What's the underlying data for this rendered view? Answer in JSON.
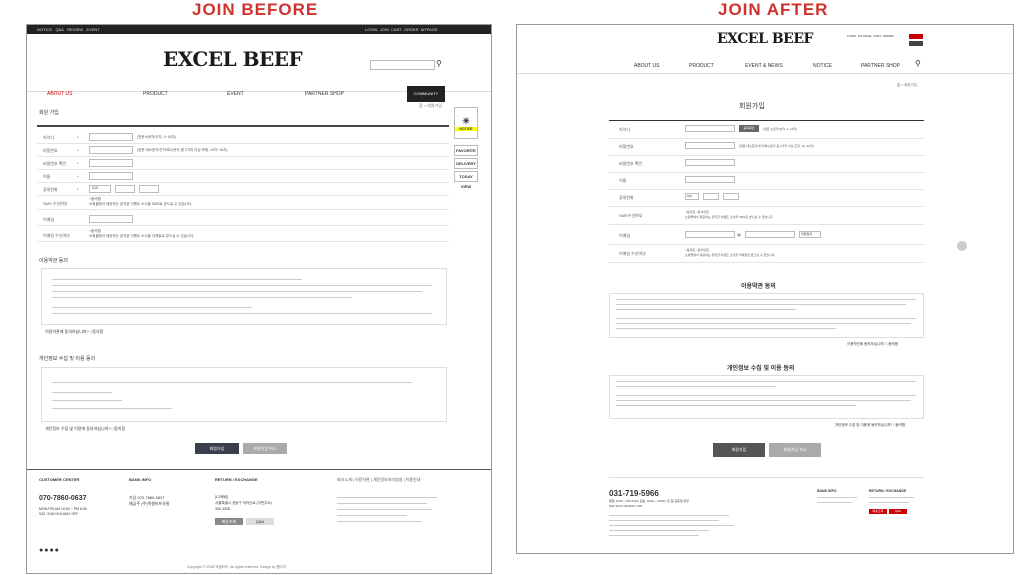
{
  "labels": {
    "before": "JOIN BEFORE",
    "after": "JOIN AFTER"
  },
  "before": {
    "topnav_left": [
      "NOTICE",
      "Q&A",
      "REVIEW",
      "EVENT"
    ],
    "topnav_right": [
      "LOGIN",
      "JOIN",
      "CART",
      "ORDER",
      "MYPAGE"
    ],
    "logo": "EXCEL BEEF",
    "mainnav": [
      "ABOUT US",
      "PRODUCT",
      "EVENT",
      "PARTNER SHOP",
      "COMMUNITY"
    ],
    "page_title": "회원 가입",
    "breadcrumb": "홈 > 회원가입",
    "form": [
      {
        "label": "아이디",
        "hint": "(영문소문자/숫자, 4~16자)"
      },
      {
        "label": "비밀번호",
        "hint": "(영문 대소문자/숫자/특수문자 중 2가지 이상 조합, 10자~16자)"
      },
      {
        "label": "비밀번호 확인",
        "hint": ""
      },
      {
        "label": "이름",
        "hint": ""
      },
      {
        "label": "휴대전화",
        "hint": ""
      },
      {
        "label": "SMS 수신여부",
        "hint": "쇼핑몰에서 제공하는 유익한 이벤트 소식을 SMS로 받으실 수 있습니다."
      },
      {
        "label": "이메일",
        "hint": ""
      },
      {
        "label": "이메일 수신여부",
        "hint": "쇼핑몰에서 제공하는 유익한 이벤트 소식을 이메일로 받으실 수 있습니다."
      }
    ],
    "phone_prefix": "010",
    "consent_opt": "동의함",
    "side_widgets": [
      "NOTICE",
      "FAVORITE",
      "DELIVERY",
      "TODAY VIEW"
    ],
    "terms_title": "이용약관 동의",
    "terms_agree": "이용약관에 동의하십니까?",
    "agree_label": "동의함",
    "privacy_title": "개인정보 수집 및 이용 동의",
    "privacy_agree": "개인정보 수집 및 이용에 동의하십니까?",
    "btn_join": "회원가입",
    "btn_cancel": "회원가입 취소",
    "footer": {
      "cc_title": "CUSTOMER CENTER",
      "cc_phone": "070-7860-0637",
      "cc_hours": "MON-FRI AM 10:00 ~ PM 6:00",
      "cc_holiday": "SAT, SUN HOLIDAY OFF",
      "bank_title": "BANK INFO",
      "bank_line1": "가상 070-7860-0637",
      "bank_line2": "예금주 (주)엑셀비프유통",
      "return_title": "RETURN / EXCHANGE",
      "return_lines": [
        "[CJ택배]",
        "서울특별시 성동구 아차산로 (지번주소)",
        "305-3338"
      ],
      "btn1": "배송조회",
      "btn2": "Q&A",
      "links": [
        "회사소개",
        "이용약관",
        "개인정보처리방침",
        "이용안내"
      ],
      "copyright": "Copyright © 2018 엑셀비프. All rights reserved. Design by 웹디자"
    }
  },
  "after": {
    "logo": "EXCEL BEEF",
    "util": [
      "LOGIN",
      "MY PAGE",
      "CART",
      "ORDER"
    ],
    "mainnav": [
      "ABOUT US",
      "PRODUCT",
      "EVENT & NEWS",
      "NOTICE",
      "PARTNER SHOP"
    ],
    "breadcrumb": "홈 > 회원가입",
    "page_title": "회원가입",
    "form": [
      {
        "label": "아이디",
        "hint": "(영문 소문자/숫자, 4~16자)"
      },
      {
        "label": "비밀번호",
        "hint": "(영문 대소문자/숫자/특수문자 중 2가지 이상 조합, 10~16자)"
      },
      {
        "label": "비밀번호 확인",
        "hint": ""
      },
      {
        "label": "이름",
        "hint": ""
      },
      {
        "label": "휴대전화",
        "hint": ""
      },
      {
        "label": "SMS수신여부",
        "hint": "쇼핑몰에서 제공하는 유익한 이벤트 소식을 SMS로 받으실 수 있습니다."
      },
      {
        "label": "이메일",
        "hint": ""
      },
      {
        "label": "이메일 수신여부",
        "hint": "쇼핑몰에서 제공하는 유익한 이벤트 소식을 이메일로 받으실 수 있습니다."
      }
    ],
    "dup_check": "중복확인",
    "phone_prefix": "010",
    "email_select": "직접입력",
    "consent": [
      "동의함",
      "동의안함"
    ],
    "terms_title": "이용약관 동의",
    "terms_agree": "이용약관에 동의하십니까?",
    "privacy_title": "개인정보 수집 및 이용 동의",
    "privacy_agree": "개인정보 수집 및 이용에 동의하십니까?",
    "agree_label": "동의함",
    "btn_join": "회원가입",
    "btn_cancel": "회원가입 취소",
    "footer": {
      "phone": "031-719-5966",
      "hours_line": "평일 10:00 ~ PM 6:00 | 점심 12:00 ~ 13:00 | 토,일,공휴일 휴무",
      "holiday": "SAT SUN HOLIDAY OFF",
      "bank_title": "BANK INFO",
      "return_title": "RETURN / EXCHANGE",
      "btn1": "배송조회",
      "btn2": "Q&A"
    }
  }
}
